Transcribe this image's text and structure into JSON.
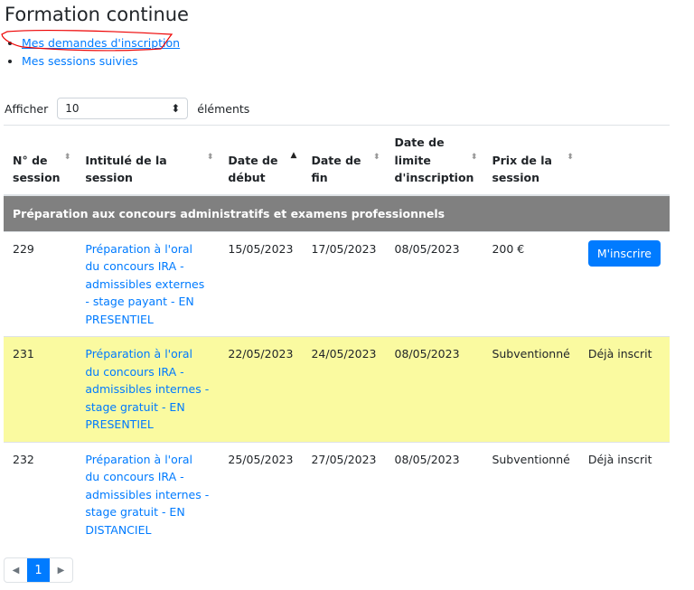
{
  "title": "Formation continue",
  "links": [
    "Mes demandes d'inscription",
    "Mes sessions suivies"
  ],
  "length": {
    "prefix": "Afficher",
    "value": "10",
    "suffix": "éléments"
  },
  "columns": [
    "N° de session",
    "Intitulé de la session",
    "Date de début",
    "Date de fin",
    "Date de limite d'inscription",
    "Prix de la session"
  ],
  "group": "Préparation aux concours administratifs et examens professionnels",
  "rows": [
    {
      "num": "229",
      "title": "Préparation à l'oral du concours IRA - admissibles externes - stage payant - EN PRESENTIEL",
      "start": "15/05/2023",
      "end": "17/05/2023",
      "limit": "08/05/2023",
      "price": "200 €",
      "action": "M'inscrire"
    },
    {
      "num": "231",
      "title": "Préparation à l'oral du concours IRA - admissibles internes - stage gratuit - EN PRESENTIEL",
      "start": "22/05/2023",
      "end": "24/05/2023",
      "limit": "08/05/2023",
      "price": "Subventionné",
      "action": "Déjà inscrit"
    },
    {
      "num": "232",
      "title": "Préparation à l'oral du concours IRA - admissibles internes - stage gratuit - EN DISTANCIEL",
      "start": "25/05/2023",
      "end": "27/05/2023",
      "limit": "08/05/2023",
      "price": "Subventionné",
      "action": "Déjà inscrit"
    }
  ],
  "pagination": {
    "current": "1"
  },
  "colors": {
    "link": "#007bff",
    "group": "#808080",
    "highlight": "#fafaa0",
    "annotation": "#ff0000"
  }
}
